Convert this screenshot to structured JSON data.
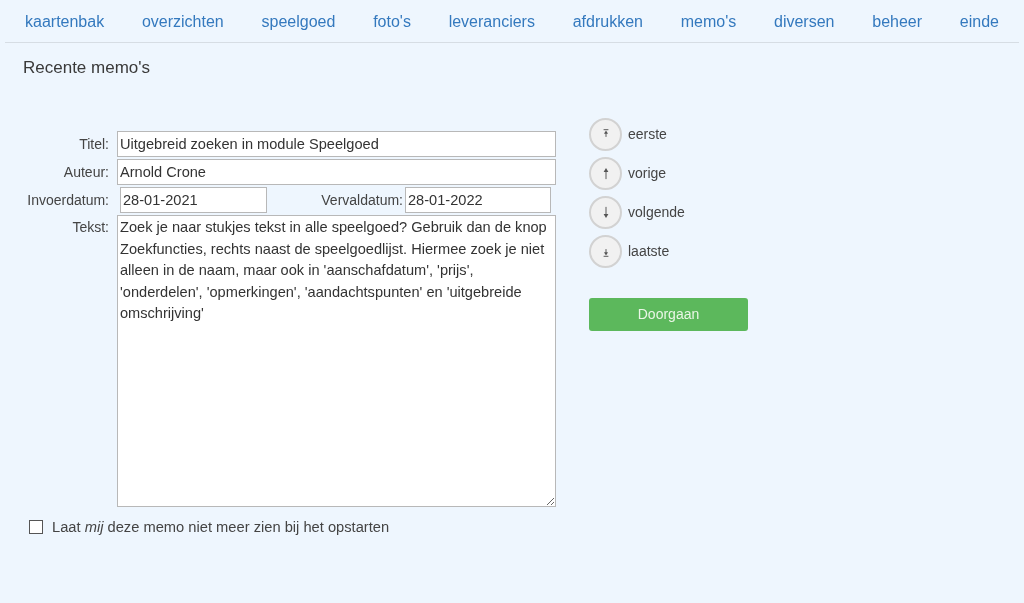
{
  "nav": {
    "items": [
      "kaartenbak",
      "overzichten",
      "speelgoed",
      "foto's",
      "leveranciers",
      "afdrukken",
      "memo's",
      "diversen",
      "beheer",
      "einde"
    ]
  },
  "page_title": "Recente memo's",
  "form": {
    "fields": [
      {
        "label": "Titel:",
        "value": "Uitgebreid zoeken in module Speelgoed"
      },
      {
        "label": "Auteur:",
        "value": "Arnold Crone"
      }
    ],
    "dates": [
      {
        "label": "Invoerdatum:",
        "value": "28-01-2021"
      },
      {
        "label": "Vervaldatum:",
        "value": "28-01-2022"
      }
    ],
    "text": {
      "label": "Tekst:",
      "value": "Zoek je naar stukjes tekst in alle speelgoed? Gebruik dan de knop Zoekfuncties, rechts naast de speelgoedlijst. Hiermee zoek je niet alleen in de naam, maar ook in 'aanschafdatum', 'prijs', 'onderdelen', 'opmerkingen', 'aandachtspunten' en 'uitgebreide omschrijving'"
    }
  },
  "record_navigation": [
    {
      "kind": "first",
      "label": "eerste"
    },
    {
      "kind": "previous",
      "label": "vorige"
    },
    {
      "kind": "next",
      "label": "volgende"
    },
    {
      "kind": "last",
      "label": "laatste"
    }
  ],
  "submit_button": "Doorgaan",
  "dont_show_again": {
    "label": "Laat *mij* deze memo niet meer zien bij het opstarten",
    "checked": false
  }
}
